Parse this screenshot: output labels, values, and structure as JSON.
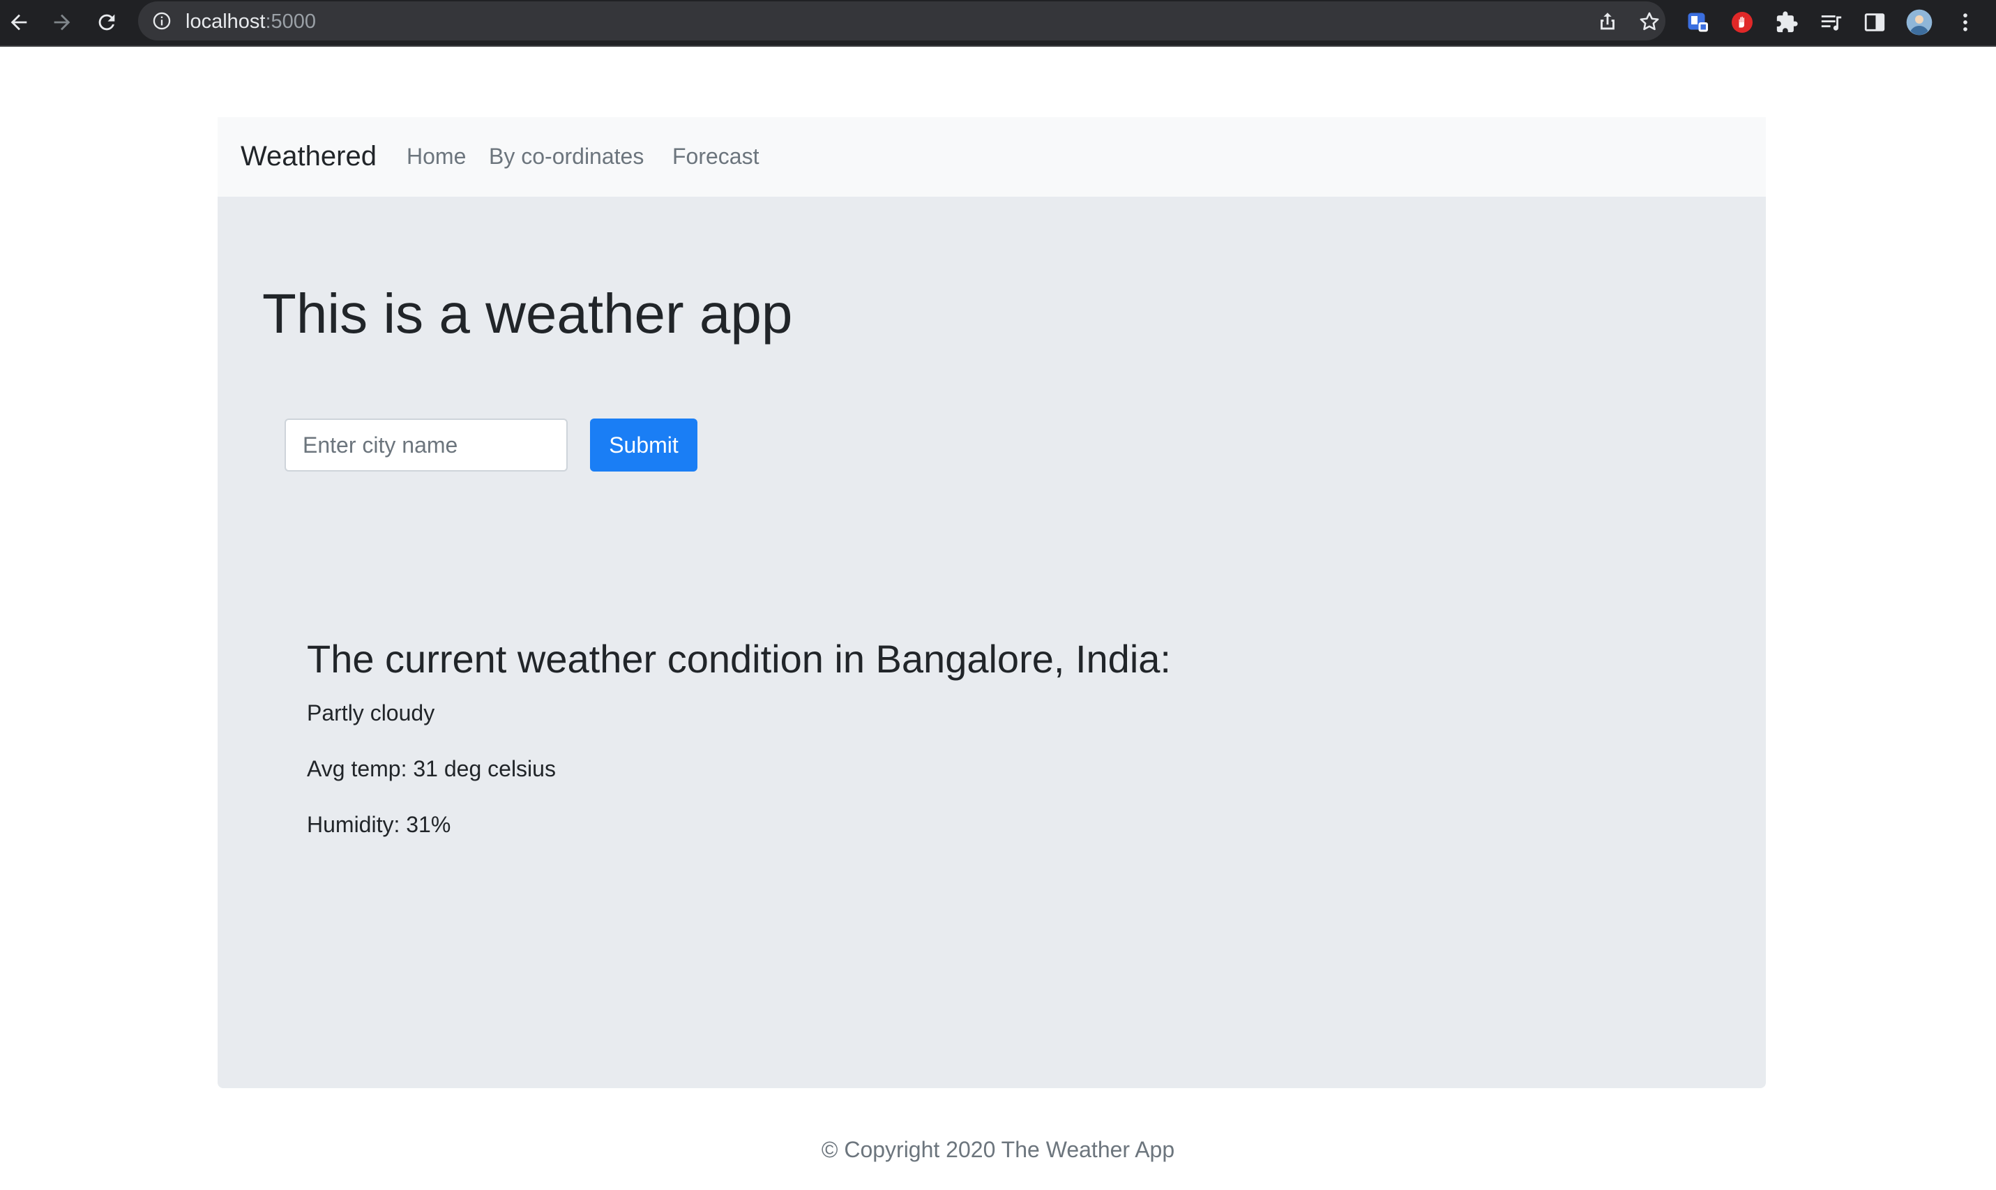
{
  "browser": {
    "url_host": "localhost",
    "url_port": ":5000",
    "icons": [
      "back-arrow-icon",
      "forward-arrow-icon",
      "reload-icon",
      "info-icon",
      "share-icon",
      "bookmark-star-icon",
      "extension-shield-icon",
      "extension-stop-icon",
      "extensions-puzzle-icon",
      "media-queue-icon",
      "side-panel-icon",
      "profile-avatar",
      "more-menu-icon"
    ]
  },
  "navbar": {
    "brand": "Weathered",
    "links": [
      "Home",
      "By co-ordinates",
      "Forecast"
    ]
  },
  "main": {
    "headline": "This is a weather app",
    "search": {
      "placeholder": "Enter city name",
      "value": ""
    },
    "submit_label": "Submit",
    "condition_title": "The current weather condition in Bangalore, India:",
    "condition": "Partly cloudy",
    "avg_temp": "Avg temp: 31 deg celsius",
    "humidity": "Humidity: 31%"
  },
  "footer": {
    "text": "© Copyright 2020 The Weather App"
  },
  "colors": {
    "chrome_bg": "#202124",
    "navbar_bg": "#f8f9fa",
    "jumbotron_bg": "#e8ebef",
    "primary_button": "#1a7ef5",
    "muted_text": "#6c757d"
  }
}
